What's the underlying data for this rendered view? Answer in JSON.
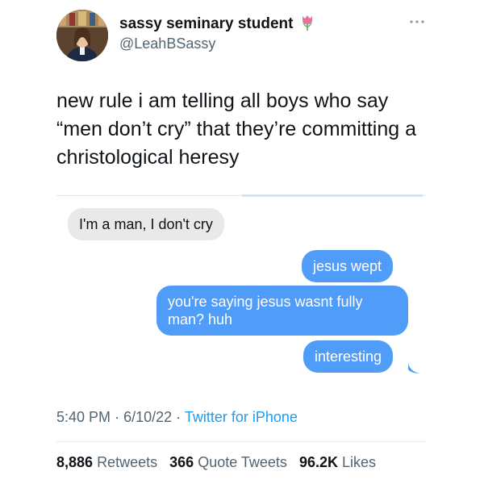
{
  "author": {
    "display_name": "sassy seminary student",
    "handle": "@LeahBSassy",
    "name_emoji_icon": "tulip-icon",
    "avatar_icon": "profile-photo",
    "menu_icon": "more-options-icon"
  },
  "tweet": {
    "text": "new rule i am telling all boys who say “men don’t cry” that they’re committing a christological heresy"
  },
  "conversation": {
    "messages": [
      {
        "side": "received",
        "text": "I'm a man, I don't cry"
      },
      {
        "side": "sent",
        "text": "jesus wept"
      },
      {
        "side": "sent",
        "text": "you're saying jesus wasnt fully man? huh"
      },
      {
        "side": "sent",
        "text": "interesting"
      }
    ]
  },
  "meta": {
    "time": "5:40 PM",
    "separator": "·",
    "date": "6/10/22",
    "source": "Twitter for iPhone"
  },
  "stats": {
    "retweets_count": "8,886",
    "retweets_label": "Retweets",
    "quotes_count": "366",
    "quotes_label": "Quote Tweets",
    "likes_count": "96.2K",
    "likes_label": "Likes"
  },
  "colors": {
    "sent_bubble": "#4f9cf9",
    "received_bubble": "#e9e9eb",
    "link": "#1d9bf0",
    "secondary_text": "#536471"
  }
}
